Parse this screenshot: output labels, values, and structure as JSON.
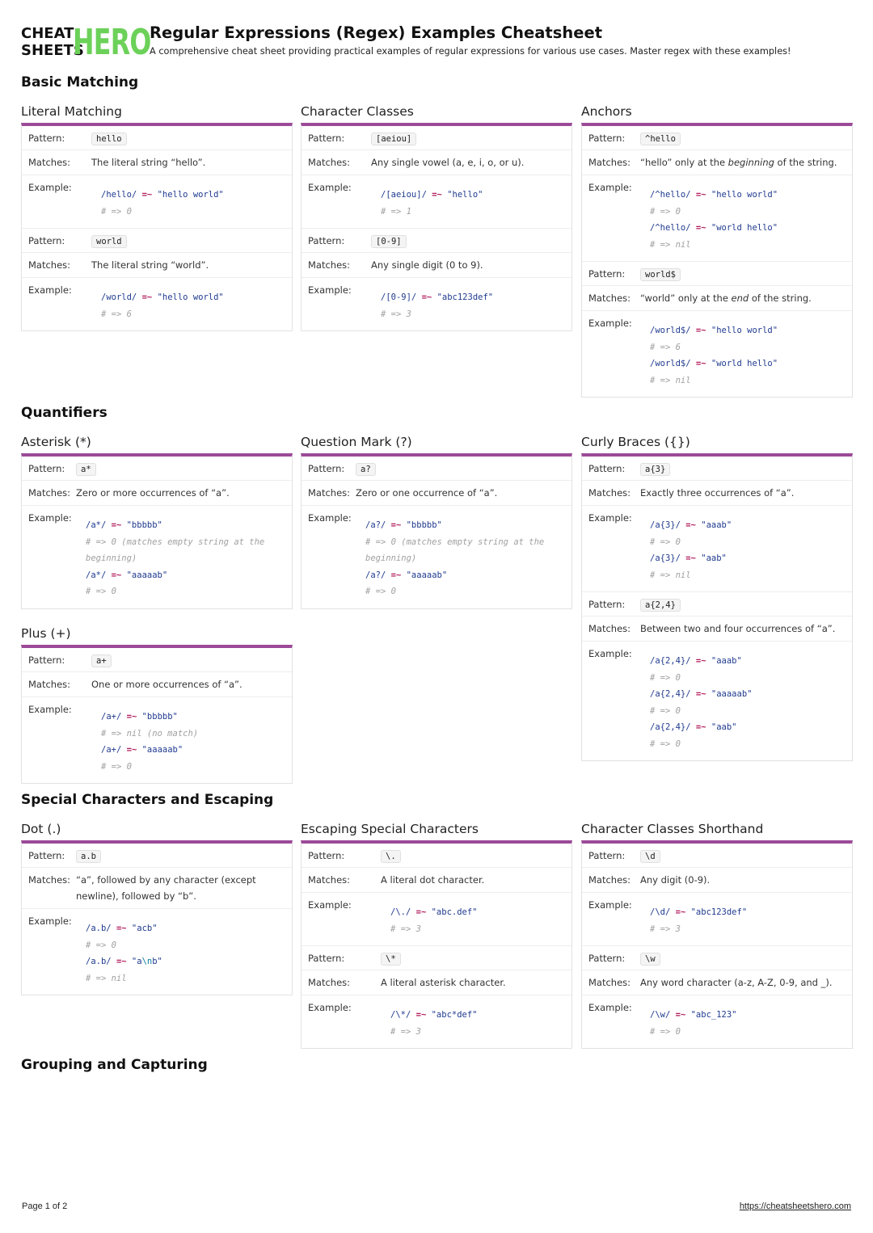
{
  "header": {
    "logo": {
      "line1": "CHEAT",
      "line2": "SHEETS",
      "accent": "HERO",
      "accent_color": "#6cd159"
    },
    "title": "Regular Expressions (Regex) Examples Cheatsheet",
    "subtitle": "A comprehensive cheat sheet providing practical examples of regular expressions for various use cases. Master regex with these examples!"
  },
  "labels": {
    "pattern": "Pattern:",
    "matches": "Matches:",
    "example": "Example:"
  },
  "colors": {
    "card_accent": "#9c4a98",
    "code_regex": "#1f3a8f",
    "code_operator": "#b0185a",
    "code_comment": "#a0a0a0"
  },
  "sections": [
    {
      "title": "Basic Matching"
    },
    {
      "title": "Quantifiers"
    },
    {
      "title": "Special Characters and Escaping"
    },
    {
      "title": "Grouping and Capturing"
    }
  ],
  "cards": {
    "literal": {
      "title": "Literal Matching",
      "entries": [
        {
          "pattern": "hello",
          "matches": "The literal string “hello”.",
          "example": [
            {
              "re": "/hello/",
              "op": "=~",
              "str": "\"hello world\""
            },
            {
              "comment": "# => 0"
            }
          ]
        },
        {
          "pattern": "world",
          "matches": "The literal string “world”.",
          "example": [
            {
              "re": "/world/",
              "op": "=~",
              "str": "\"hello world\""
            },
            {
              "comment": "# => 6"
            }
          ]
        }
      ]
    },
    "charclass": {
      "title": "Character Classes",
      "entries": [
        {
          "pattern": "[aeiou]",
          "matches": "Any single vowel (a, e, i, o, or u).",
          "example": [
            {
              "re": "/[aeiou]/",
              "op": "=~",
              "str": "\"hello\""
            },
            {
              "comment": "# => 1"
            }
          ]
        },
        {
          "pattern": "[0-9]",
          "matches": "Any single digit (0 to 9).",
          "example": [
            {
              "re": "/[0-9]/",
              "op": "=~",
              "str": "\"abc123def\""
            },
            {
              "comment": "# => 3"
            }
          ]
        }
      ]
    },
    "anchors": {
      "title": "Anchors",
      "entries": [
        {
          "pattern": "^hello",
          "matches_pre": "“hello” only at the ",
          "matches_em": "beginning",
          "matches_post": " of the string.",
          "example": [
            {
              "re": "/^hello/",
              "op": "=~",
              "str": "\"hello world\""
            },
            {
              "comment": "# => 0"
            },
            {
              "re": "/^hello/",
              "op": "=~",
              "str": "\"world hello\""
            },
            {
              "comment": "# => nil"
            }
          ]
        },
        {
          "pattern": "world$",
          "matches_pre": "“world” only at the ",
          "matches_em": "end",
          "matches_post": " of the string.",
          "example": [
            {
              "re": "/world$/",
              "op": "=~",
              "str": "\"hello world\""
            },
            {
              "comment": "# => 6"
            },
            {
              "re": "/world$/",
              "op": "=~",
              "str": "\"world hello\""
            },
            {
              "comment": "# => nil"
            }
          ]
        }
      ]
    },
    "asterisk": {
      "title": "Asterisk (*)",
      "entries": [
        {
          "pattern": "a*",
          "matches": "Zero or more occurrences of “a”.",
          "example": [
            {
              "re": "/a*/",
              "op": "=~",
              "str": "\"bbbbb\""
            },
            {
              "comment": "# => 0 (matches empty string at the beginning)"
            },
            {
              "re": "/a*/",
              "op": "=~",
              "str": "\"aaaaab\""
            },
            {
              "comment": "# => 0"
            }
          ]
        }
      ]
    },
    "question": {
      "title": "Question Mark (?)",
      "entries": [
        {
          "pattern": "a?",
          "matches": "Zero or one occurrence of “a”.",
          "example": [
            {
              "re": "/a?/",
              "op": "=~",
              "str": "\"bbbbb\""
            },
            {
              "comment": "# => 0 (matches empty string at the beginning)"
            },
            {
              "re": "/a?/",
              "op": "=~",
              "str": "\"aaaaab\""
            },
            {
              "comment": "# => 0"
            }
          ]
        }
      ]
    },
    "curly": {
      "title": "Curly Braces ({})",
      "entries": [
        {
          "pattern": "a{3}",
          "matches": "Exactly three occurrences of “a”.",
          "example": [
            {
              "re": "/a{3}/",
              "op": "=~",
              "str": "\"aaab\""
            },
            {
              "comment": "# => 0"
            },
            {
              "re": "/a{3}/",
              "op": "=~",
              "str": "\"aab\""
            },
            {
              "comment": "# => nil"
            }
          ]
        },
        {
          "pattern": "a{2,4}",
          "matches": "Between two and four occurrences of “a”.",
          "example": [
            {
              "re": "/a{2,4}/",
              "op": "=~",
              "str": "\"aaab\""
            },
            {
              "comment": "# => 0"
            },
            {
              "re": "/a{2,4}/",
              "op": "=~",
              "str": "\"aaaaab\""
            },
            {
              "comment": "# => 0"
            },
            {
              "re": "/a{2,4}/",
              "op": "=~",
              "str": "\"aab\""
            },
            {
              "comment": "# => 0"
            }
          ]
        }
      ]
    },
    "plus": {
      "title": "Plus (+)",
      "entries": [
        {
          "pattern": "a+",
          "matches": "One or more occurrences of “a”.",
          "example": [
            {
              "re": "/a+/",
              "op": "=~",
              "str": "\"bbbbb\""
            },
            {
              "comment": "# => nil (no match)"
            },
            {
              "re": "/a+/",
              "op": "=~",
              "str": "\"aaaaab\""
            },
            {
              "comment": "# => 0"
            }
          ]
        }
      ]
    },
    "dot": {
      "title": "Dot (.)",
      "entries": [
        {
          "pattern": "a.b",
          "matches": "“a”, followed by any character (except newline), followed by “b”.",
          "example": [
            {
              "re": "/a.b/",
              "op": "=~",
              "str": "\"acb\""
            },
            {
              "comment": "# => 0"
            },
            {
              "re": "/a.b/",
              "op": "=~",
              "str_pre": "\"a",
              "esc": "\\n",
              "str_post": "b\""
            },
            {
              "comment": "# => nil"
            }
          ]
        }
      ]
    },
    "escaping": {
      "title": "Escaping Special Characters",
      "entries": [
        {
          "pattern": "\\.",
          "matches": "A literal dot character.",
          "example": [
            {
              "re": "/\\./",
              "op": "=~",
              "str": "\"abc.def\""
            },
            {
              "comment": "# => 3"
            }
          ]
        },
        {
          "pattern": "\\*",
          "matches": "A literal asterisk character.",
          "example": [
            {
              "re": "/\\*/",
              "op": "=~",
              "str": "\"abc*def\""
            },
            {
              "comment": "# => 3"
            }
          ]
        }
      ]
    },
    "shorthand": {
      "title": "Character Classes Shorthand",
      "entries": [
        {
          "pattern": "\\d",
          "matches": "Any digit (0-9).",
          "example": [
            {
              "re": "/\\d/",
              "op": "=~",
              "str": "\"abc123def\""
            },
            {
              "comment": "# => 3"
            }
          ]
        },
        {
          "pattern": "\\w",
          "matches": "Any word character (a-z, A-Z, 0-9, and _).",
          "example": [
            {
              "re": "/\\w/",
              "op": "=~",
              "str": "\"abc_123\""
            },
            {
              "comment": "# => 0"
            }
          ]
        }
      ]
    }
  },
  "footer": {
    "page": "Page 1 of 2",
    "url": "https://cheatsheetshero.com"
  }
}
